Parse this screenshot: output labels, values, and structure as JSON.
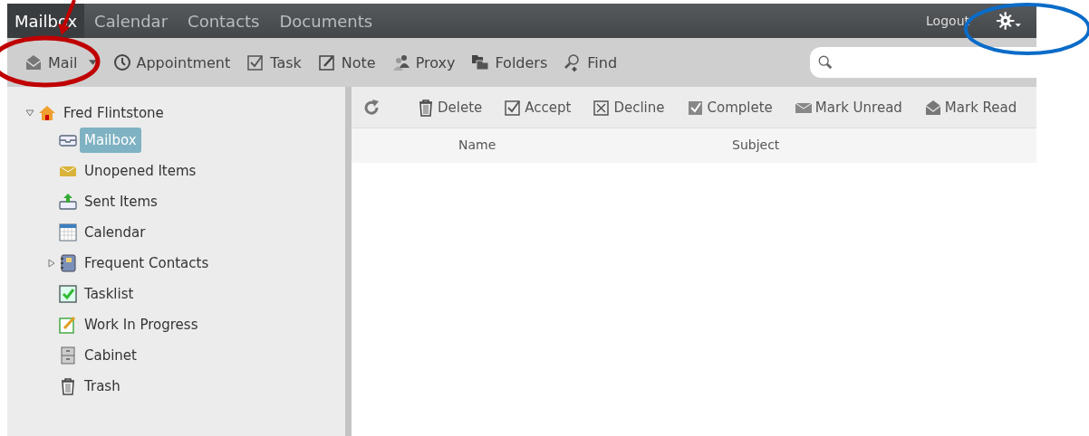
{
  "top_tabs": [
    {
      "label": "Mailbox",
      "selected": true
    },
    {
      "label": "Calendar",
      "selected": false
    },
    {
      "label": "Contacts",
      "selected": false
    },
    {
      "label": "Documents",
      "selected": false
    }
  ],
  "logout": "Logout",
  "toolbar": [
    {
      "label": "Mail",
      "kind": "mail",
      "dropdown": true
    },
    {
      "label": "Appointment",
      "kind": "clock",
      "dropdown": false
    },
    {
      "label": "Task",
      "kind": "check",
      "dropdown": false
    },
    {
      "label": "Note",
      "kind": "note",
      "dropdown": false
    },
    {
      "label": "Proxy",
      "kind": "people",
      "dropdown": false
    },
    {
      "label": "Folders",
      "kind": "folders",
      "dropdown": false
    },
    {
      "label": "Find",
      "kind": "find",
      "dropdown": false
    }
  ],
  "tree": {
    "label": "Fred Flintstone",
    "kind": "home",
    "expanded": true,
    "children": [
      {
        "label": "Mailbox",
        "kind": "mailbox",
        "selected": true
      },
      {
        "label": "Unopened Items",
        "kind": "envelope",
        "selected": false
      },
      {
        "label": "Sent Items",
        "kind": "sent",
        "selected": false
      },
      {
        "label": "Calendar",
        "kind": "calendar",
        "selected": false
      },
      {
        "label": "Frequent Contacts",
        "kind": "contacts",
        "selected": false,
        "expanded": false
      },
      {
        "label": "Tasklist",
        "kind": "tasklist",
        "selected": false
      },
      {
        "label": "Work In Progress",
        "kind": "wip",
        "selected": false
      },
      {
        "label": "Cabinet",
        "kind": "cabinet",
        "selected": false
      },
      {
        "label": "Trash",
        "kind": "trash",
        "selected": false
      }
    ]
  },
  "actions": [
    {
      "label": "Delete",
      "kind": "trash"
    },
    {
      "label": "Accept",
      "kind": "check"
    },
    {
      "label": "Decline",
      "kind": "cross"
    },
    {
      "label": "Complete",
      "kind": "checked"
    },
    {
      "label": "Mark Unread",
      "kind": "envelope"
    },
    {
      "label": "Mark Read",
      "kind": "open"
    }
  ],
  "columns": [
    {
      "label": "Name"
    },
    {
      "label": "Subject"
    }
  ]
}
